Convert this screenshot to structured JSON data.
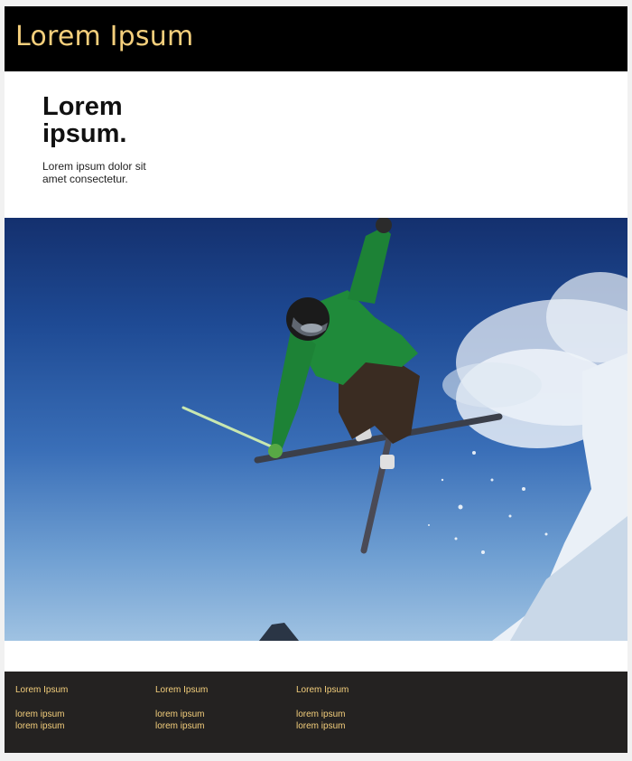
{
  "header": {
    "title": "Lorem Ipsum"
  },
  "intro": {
    "heading": "Lorem ipsum.",
    "text": "Lorem ipsum dolor sit amet consectetur."
  },
  "hero": {
    "subject": "skier-jumping-photo"
  },
  "footer": {
    "columns": [
      {
        "title": "Lorem Ipsum",
        "links": [
          "lorem ipsum",
          "lorem ipsum"
        ]
      },
      {
        "title": "Lorem Ipsum",
        "links": [
          "lorem ipsum",
          "lorem  ipsum"
        ]
      },
      {
        "title": "Lorem Ipsum",
        "links": [
          "lorem ipsum",
          "lorem ipsum"
        ]
      }
    ]
  },
  "colors": {
    "accent": "#f4cf7c",
    "header_bg": "#000000",
    "footer_bg": "#242221",
    "jacket_green": "#1f8a3a"
  }
}
